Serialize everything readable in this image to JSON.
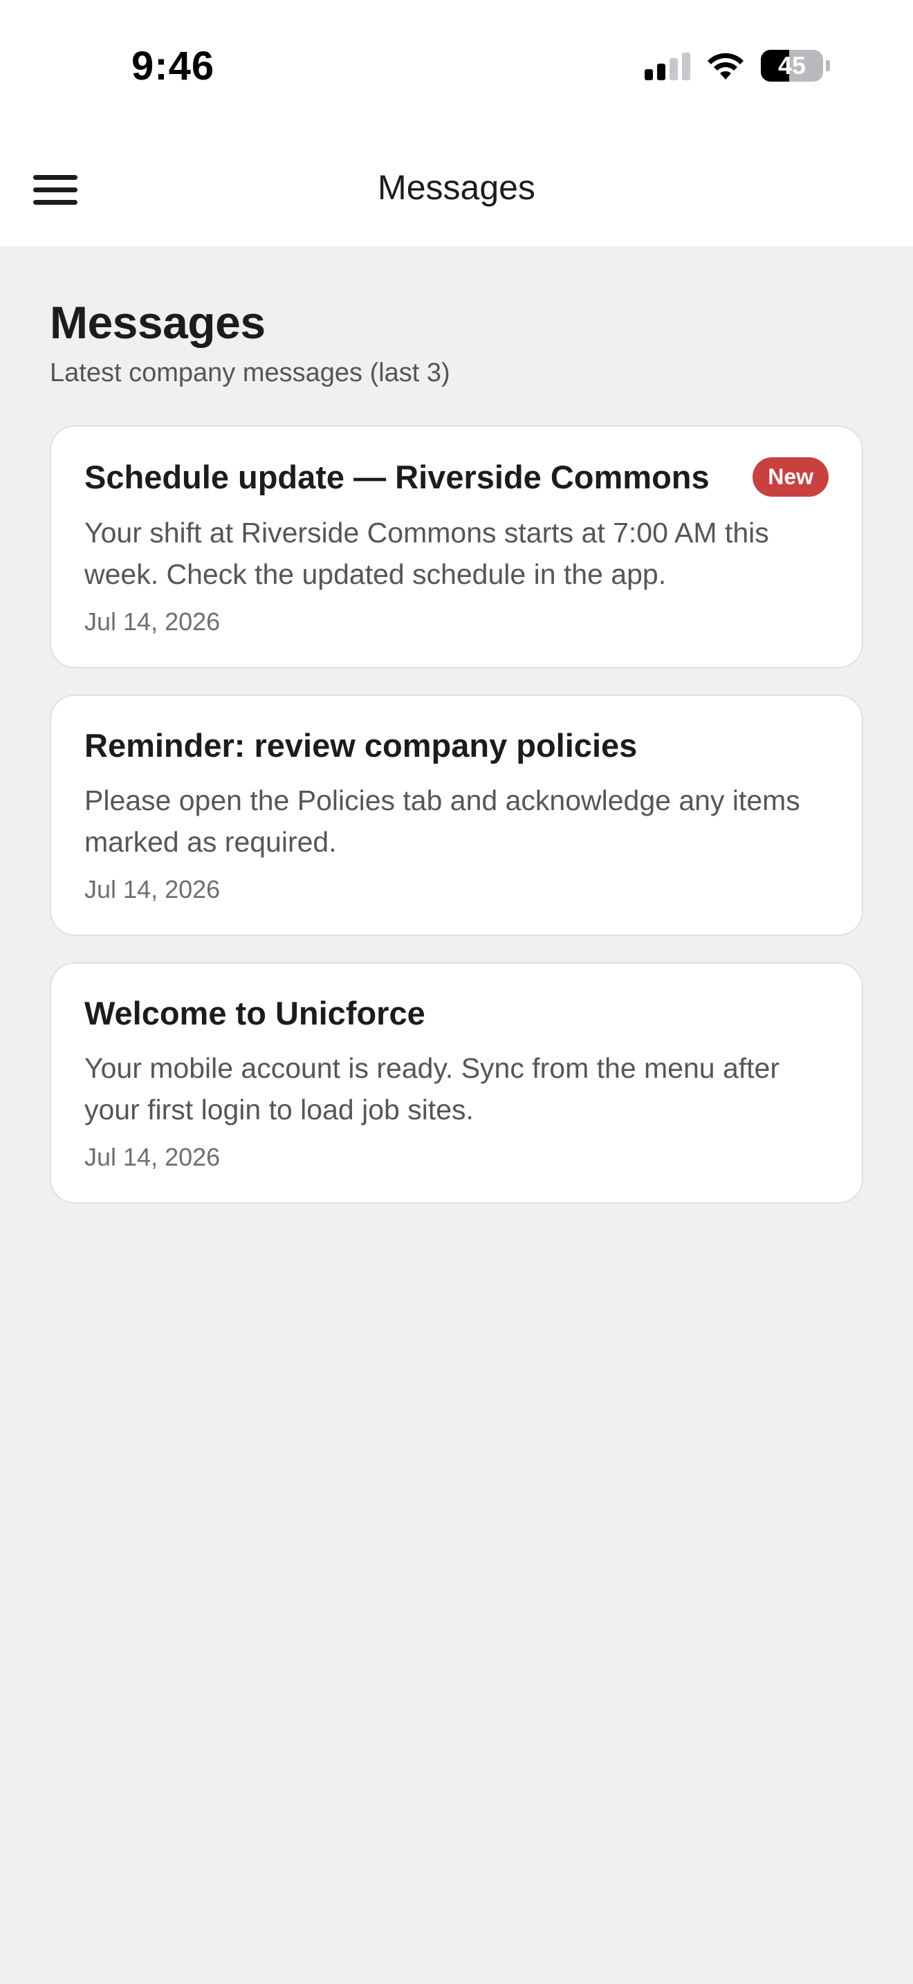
{
  "status_bar": {
    "time": "9:46",
    "battery_percent": "45",
    "battery_level": 0.45,
    "icons": [
      "cellular-signal-icon",
      "wifi-icon",
      "battery-icon"
    ]
  },
  "nav": {
    "title": "Messages",
    "menu_icon": "hamburger-menu-icon"
  },
  "page": {
    "title": "Messages",
    "subtitle": "Latest company messages (last 3)"
  },
  "messages": [
    {
      "title": "Schedule update — Riverside Commons",
      "badge": "New",
      "body": "Your shift at Riverside Commons starts at 7:00 AM this week. Check the updated schedule in the app.",
      "date": "Jul 14, 2026"
    },
    {
      "title": "Reminder: review company policies",
      "body": "Please open the Policies tab and acknowledge any items marked as required.",
      "date": "Jul 14, 2026"
    },
    {
      "title": "Welcome to Unicforce",
      "body": "Your mobile account is ready. Sync from the menu after your first login to load job sites.",
      "date": "Jul 14, 2026"
    }
  ],
  "colors": {
    "badge_new": "#c8413f",
    "background": "#f0f0f0",
    "card": "#ffffff"
  }
}
